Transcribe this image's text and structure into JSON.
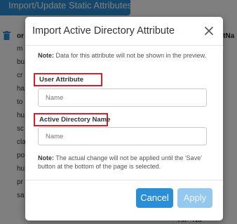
{
  "background": {
    "import_button_label": "Import/Update Static Attributes (.csv)",
    "column_left_header": "or",
    "column_right_header": "untNa",
    "row_fragments": [
      "m",
      "bu",
      "cr",
      "ha",
      "to",
      "hu",
      "sc",
      "cla",
      "po",
      "hu",
      "pr",
      "sa"
    ],
    "footer_fragment": "Alt - Na"
  },
  "modal": {
    "title": "Import Active Directory Attribute",
    "note_top_label": "Note:",
    "note_top_text": " Data for this attribute will not be shown in the preview.",
    "user_attribute_label": "User Attribute",
    "user_attribute_placeholder": "Name",
    "ad_name_label": "Active Directory Name",
    "ad_name_placeholder": "Name",
    "note_bottom_label": "Note:",
    "note_bottom_text": " The actual change will not be applied until the 'Save' button at the bottom of the page is selected.",
    "cancel_label": "Cancel",
    "apply_label": "Apply"
  },
  "colors": {
    "primary": "#2b8fd8",
    "primary_disabled": "#94c8ee",
    "highlight_border": "#d21f2a"
  },
  "icons": {
    "close": "close-icon",
    "trash": "trash-icon"
  }
}
